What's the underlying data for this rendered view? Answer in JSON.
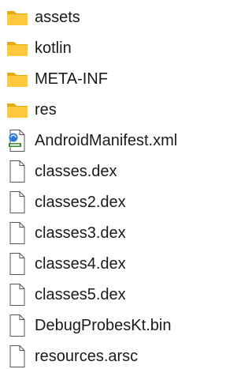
{
  "files": [
    {
      "name": "assets",
      "icon": "folder-icon"
    },
    {
      "name": "kotlin",
      "icon": "folder-icon"
    },
    {
      "name": "META-INF",
      "icon": "folder-icon"
    },
    {
      "name": "res",
      "icon": "folder-icon"
    },
    {
      "name": "AndroidManifest.xml",
      "icon": "xml-file-icon"
    },
    {
      "name": "classes.dex",
      "icon": "generic-file-icon"
    },
    {
      "name": "classes2.dex",
      "icon": "generic-file-icon"
    },
    {
      "name": "classes3.dex",
      "icon": "generic-file-icon"
    },
    {
      "name": "classes4.dex",
      "icon": "generic-file-icon"
    },
    {
      "name": "classes5.dex",
      "icon": "generic-file-icon"
    },
    {
      "name": "DebugProbesKt.bin",
      "icon": "generic-file-icon"
    },
    {
      "name": "resources.arsc",
      "icon": "generic-file-icon"
    }
  ],
  "colors": {
    "folder_back": "#E8A900",
    "folder_front": "#FFC83D",
    "file_outline": "#555555",
    "file_fill": "#FFFFFF",
    "xml_accent": "#2B7CD3"
  }
}
